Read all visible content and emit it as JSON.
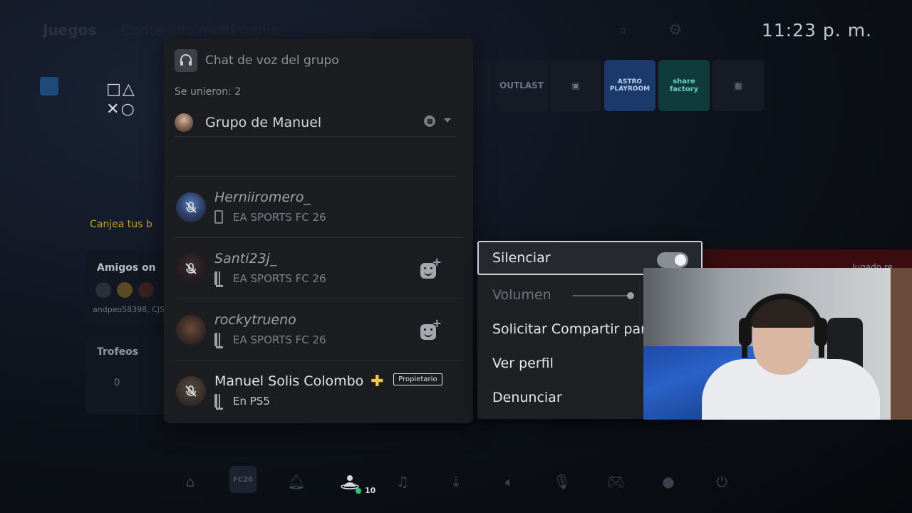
{
  "clock": "11:23 p. m.",
  "background": {
    "tabs": [
      "Juegos",
      "Contenido multimedia"
    ],
    "tiles": [
      "OUTLAST",
      "ASTRO PLAYROOM",
      "share factory"
    ],
    "promo": "Canjea tus b",
    "friends_title": "Amigos on",
    "friends_names": "andpeo58398, CJS",
    "trophies_title": "Trofeos",
    "trophies_value": "0",
    "right_text": "Jugado re"
  },
  "voice_chat": {
    "title": "Chat de voz del grupo",
    "joined_label": "Se unieron: 2",
    "group_name": "Grupo de Manuel",
    "members": [
      {
        "name": "Herniiromero_",
        "status": "EA SPORTS FC 26",
        "device": "phone",
        "add_friend": false,
        "owner": false
      },
      {
        "name": "Santi23j_",
        "status": "EA SPORTS FC 26",
        "device": "ps5",
        "add_friend": true,
        "owner": false
      },
      {
        "name": "rockytrueno",
        "status": "EA SPORTS FC 26",
        "device": "ps5",
        "add_friend": true,
        "owner": false
      },
      {
        "name": "Manuel Solis Colombo",
        "status": "En PS5",
        "device": "ps5",
        "add_friend": false,
        "owner": true,
        "owner_label": "Propietario"
      }
    ]
  },
  "context_menu": {
    "items": [
      {
        "label": "Silenciar",
        "state": "on"
      },
      {
        "label": "Volumen",
        "slider_value": 0.95
      },
      {
        "label": "Solicitar Compartir pant"
      },
      {
        "label": "Ver perfil"
      },
      {
        "label": "Denunciar"
      }
    ]
  },
  "control_center": {
    "game_tile": "FC26",
    "game_base_count": "10"
  },
  "colors": {
    "online_dot": "#2ecc71",
    "plus_badge": "#f2c94c",
    "panel_bg": "#1b1d21"
  }
}
